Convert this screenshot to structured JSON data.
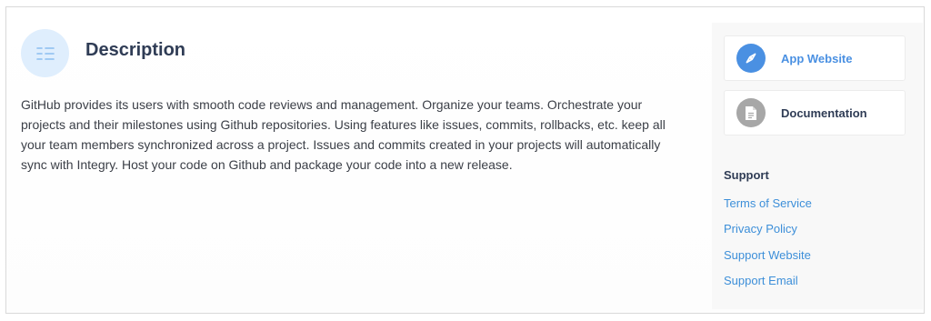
{
  "description": {
    "title": "Description",
    "text": "GitHub provides its users with smooth code reviews and management. Organize your teams. Orchestrate your projects and their milestones using Github repositories. Using features like issues, commits, rollbacks, etc. keep all your team members synchronized across a project. Issues and commits created in your projects will automatically sync with Integry. Host your code on Github and package your code into a new release.",
    "icon": "list-icon"
  },
  "sidebar": {
    "app_website": {
      "label": "App Website",
      "icon": "compass-icon",
      "color": "#4a90e2"
    },
    "documentation": {
      "label": "Documentation",
      "icon": "document-icon",
      "color": "#2f3c55"
    },
    "support": {
      "title": "Support",
      "links": [
        "Terms of Service",
        "Privacy Policy",
        "Support Website",
        "Support Email"
      ]
    }
  },
  "colors": {
    "accent": "#4a90e2",
    "link": "#3d8fd9",
    "heading": "#2f3c55",
    "icon_bg_light": "#dfeefd",
    "icon_bg_gray": "#a7a7a7"
  }
}
